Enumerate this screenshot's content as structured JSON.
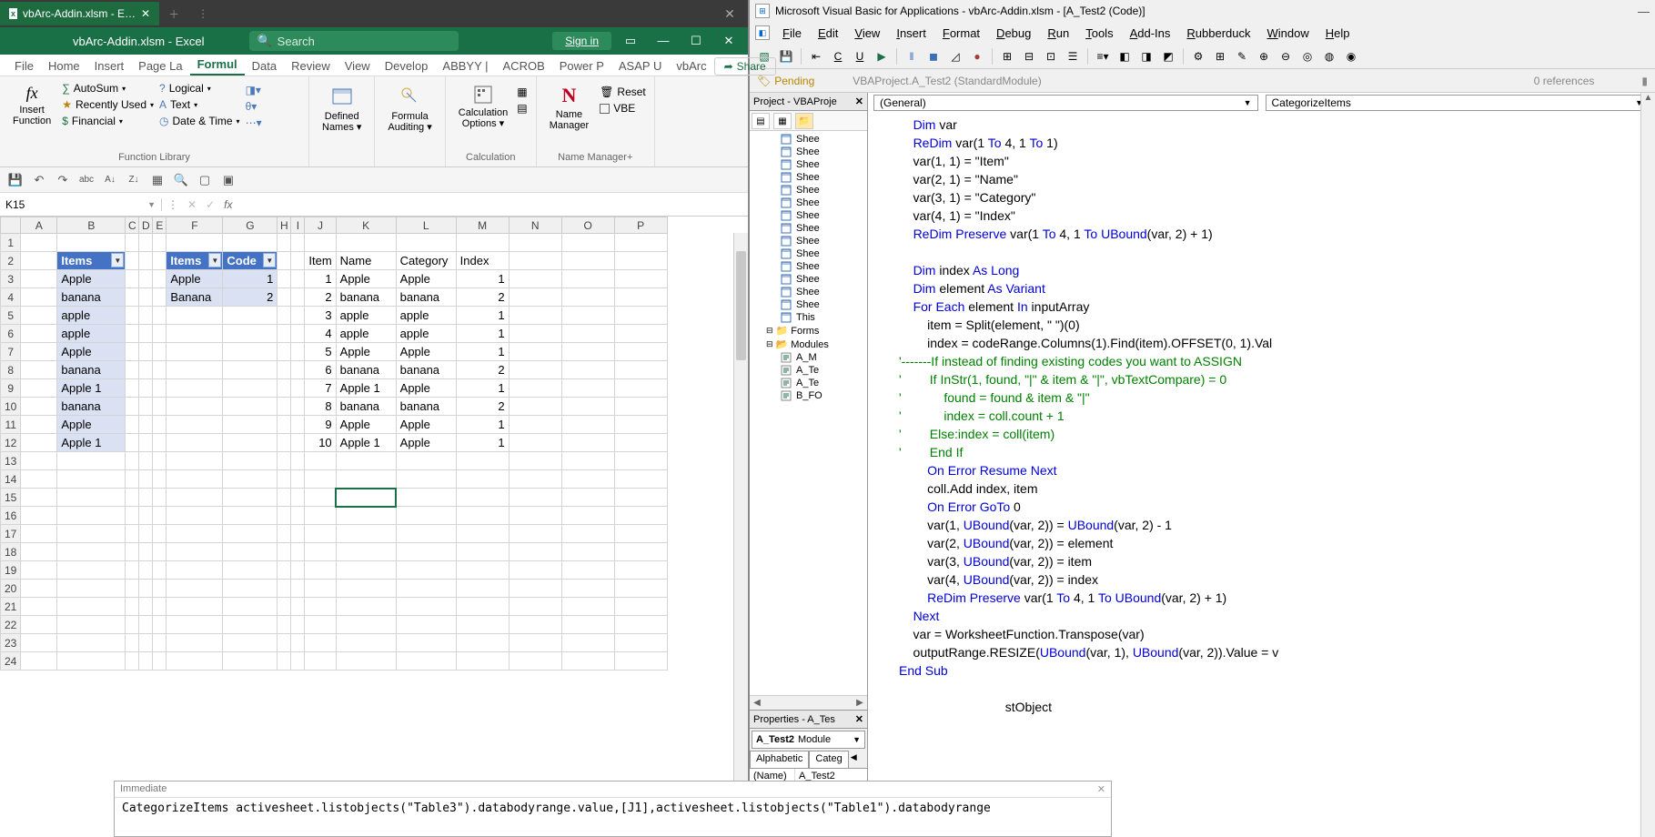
{
  "excel": {
    "tab_label": "vbArc-Addin.xlsm - E…",
    "doc_title": "vbArc-Addin.xlsm  -  Excel",
    "search_placeholder": "Search",
    "signin": "Sign in",
    "ribbon_tabs": [
      "File",
      "Home",
      "Insert",
      "Page La",
      "Formul",
      "Data",
      "Review",
      "View",
      "Develop",
      "ABBYY |",
      "ACROB",
      "Power P",
      "ASAP U",
      "vbArc"
    ],
    "share": "Share",
    "fn_group": {
      "insert_fn": "Insert\nFunction",
      "autosum": "AutoSum",
      "recent": "Recently Used",
      "financial": "Financial",
      "logical": "Logical",
      "text": "Text",
      "datetime": "Date & Time",
      "label": "Function Library"
    },
    "defined_names": "Defined\nNames",
    "formula_auditing": "Formula\nAuditing",
    "calc_options": "Calculation\nOptions",
    "calc_label": "Calculation",
    "name_mgr": "Name\nManager",
    "reset": "Reset",
    "vbe_chk": "VBE",
    "name_mgr_label": "Name Manager+",
    "namebox": "K15",
    "cols": [
      "",
      "A",
      "B",
      "C",
      "D",
      "E",
      "F",
      "G",
      "H",
      "I",
      "J",
      "K",
      "L",
      "M",
      "N",
      "O",
      "P"
    ],
    "table1_hdr": [
      "Items"
    ],
    "table1": [
      "Apple",
      "banana",
      "apple",
      "apple",
      "Apple",
      "banana",
      "Apple 1",
      "banana",
      "Apple",
      "Apple 1"
    ],
    "table2_hdr": [
      "Items",
      "Code"
    ],
    "table2": [
      [
        "Apple",
        "1"
      ],
      [
        "Banana",
        "2"
      ]
    ],
    "table3_hdr": [
      "Item",
      "Name",
      "Category",
      "Index"
    ],
    "table3": [
      [
        "1",
        "Apple",
        "Apple",
        "1"
      ],
      [
        "2",
        "banana",
        "banana",
        "2"
      ],
      [
        "3",
        "apple",
        "apple",
        "1"
      ],
      [
        "4",
        "apple",
        "apple",
        "1"
      ],
      [
        "5",
        "Apple",
        "Apple",
        "1"
      ],
      [
        "6",
        "banana",
        "banana",
        "2"
      ],
      [
        "7",
        "Apple 1",
        "Apple",
        "1"
      ],
      [
        "8",
        "banana",
        "banana",
        "2"
      ],
      [
        "9",
        "Apple",
        "Apple",
        "1"
      ],
      [
        "10",
        "Apple 1",
        "Apple",
        "1"
      ]
    ]
  },
  "immediate": {
    "title": "Immediate",
    "body": "CategorizeItems activesheet.listobjects(\"Table3\").databodyrange.value,[J1],activesheet.listobjects(\"Table1\").databodyrange"
  },
  "vbe": {
    "title": "Microsoft Visual Basic for Applications - vbArc-Addin.xlsm - [A_Test2 (Code)]",
    "menus": [
      "File",
      "Edit",
      "View",
      "Insert",
      "Format",
      "Debug",
      "Run",
      "Tools",
      "Add-Ins",
      "Rubberduck",
      "Window",
      "Help"
    ],
    "pending": "Pending",
    "module_path": "VBAProject.A_Test2 (StandardModule)",
    "refs": "0 references",
    "project_title": "Project - VBAProje",
    "tree_sheets": [
      "Shee",
      "Shee",
      "Shee",
      "Shee",
      "Shee",
      "Shee",
      "Shee",
      "Shee",
      "Shee",
      "Shee",
      "Shee",
      "Shee",
      "Shee",
      "Shee",
      "This"
    ],
    "tree_forms": "Forms",
    "tree_modules": "Modules",
    "tree_mods": [
      "A_M",
      "A_Te",
      "A_Te",
      "B_FO"
    ],
    "props_title": "Properties - A_Tes",
    "props_module": "A_Test2",
    "props_type": "Module",
    "props_tabs": [
      "Alphabetic",
      "Categ"
    ],
    "props_name_k": "(Name)",
    "props_name_v": "A_Test2",
    "code_dd1": "(General)",
    "code_dd2": "CategorizeItems",
    "code_lines": [
      [
        {
          "t": "    "
        },
        {
          "t": "Dim",
          "c": "kw"
        },
        {
          "t": " var"
        }
      ],
      [
        {
          "t": "    "
        },
        {
          "t": "ReDim",
          "c": "kw"
        },
        {
          "t": " var(1 "
        },
        {
          "t": "To",
          "c": "kw"
        },
        {
          "t": " 4, 1 "
        },
        {
          "t": "To",
          "c": "kw"
        },
        {
          "t": " 1)"
        }
      ],
      [
        {
          "t": "    var(1, 1) = \"Item\""
        }
      ],
      [
        {
          "t": "    var(2, 1) = \"Name\""
        }
      ],
      [
        {
          "t": "    var(3, 1) = \"Category\""
        }
      ],
      [
        {
          "t": "    var(4, 1) = \"Index\""
        }
      ],
      [
        {
          "t": "    "
        },
        {
          "t": "ReDim Preserve",
          "c": "kw"
        },
        {
          "t": " var(1 "
        },
        {
          "t": "To",
          "c": "kw"
        },
        {
          "t": " 4, 1 "
        },
        {
          "t": "To",
          "c": "kw"
        },
        {
          "t": " "
        },
        {
          "t": "UBound",
          "c": "kw"
        },
        {
          "t": "(var, 2) + 1)"
        }
      ],
      [
        {
          "t": "    "
        }
      ],
      [
        {
          "t": "    "
        },
        {
          "t": "Dim",
          "c": "kw"
        },
        {
          "t": " index "
        },
        {
          "t": "As Long",
          "c": "kw"
        }
      ],
      [
        {
          "t": "    "
        },
        {
          "t": "Dim",
          "c": "kw"
        },
        {
          "t": " element "
        },
        {
          "t": "As Variant",
          "c": "kw"
        }
      ],
      [
        {
          "t": "    "
        },
        {
          "t": "For Each",
          "c": "kw"
        },
        {
          "t": " element "
        },
        {
          "t": "In",
          "c": "kw"
        },
        {
          "t": " inputArray"
        }
      ],
      [
        {
          "t": "        item = Split(element, \" \")(0)"
        }
      ],
      [
        {
          "t": "        index = codeRange.Columns(1).Find(item).OFFSET(0, 1).Val"
        }
      ],
      [
        {
          "t": "'-------If instead of finding existing codes you want to ASSIGN",
          "c": "cm"
        }
      ],
      [
        {
          "t": "'        If InStr(1, found, \"|\" & item & \"|\", vbTextCompare) = 0",
          "c": "cm"
        }
      ],
      [
        {
          "t": "'            found = found & item & \"|\"",
          "c": "cm"
        }
      ],
      [
        {
          "t": "'            index = coll.count + 1",
          "c": "cm"
        }
      ],
      [
        {
          "t": "'        Else:index = coll(item)",
          "c": "cm"
        }
      ],
      [
        {
          "t": "'        End If",
          "c": "cm"
        }
      ],
      [
        {
          "t": "        "
        },
        {
          "t": "On Error Resume Next",
          "c": "kw"
        }
      ],
      [
        {
          "t": "        coll.Add index, item"
        }
      ],
      [
        {
          "t": "        "
        },
        {
          "t": "On Error GoTo",
          "c": "kw"
        },
        {
          "t": " 0"
        }
      ],
      [
        {
          "t": "        var(1, "
        },
        {
          "t": "UBound",
          "c": "kw"
        },
        {
          "t": "(var, 2)) = "
        },
        {
          "t": "UBound",
          "c": "kw"
        },
        {
          "t": "(var, 2) - 1"
        }
      ],
      [
        {
          "t": "        var(2, "
        },
        {
          "t": "UBound",
          "c": "kw"
        },
        {
          "t": "(var, 2)) = element"
        }
      ],
      [
        {
          "t": "        var(3, "
        },
        {
          "t": "UBound",
          "c": "kw"
        },
        {
          "t": "(var, 2)) = item"
        }
      ],
      [
        {
          "t": "        var(4, "
        },
        {
          "t": "UBound",
          "c": "kw"
        },
        {
          "t": "(var, 2)) = index"
        }
      ],
      [
        {
          "t": "        "
        },
        {
          "t": "ReDim Preserve",
          "c": "kw"
        },
        {
          "t": " var(1 "
        },
        {
          "t": "To",
          "c": "kw"
        },
        {
          "t": " 4, 1 "
        },
        {
          "t": "To",
          "c": "kw"
        },
        {
          "t": " "
        },
        {
          "t": "UBound",
          "c": "kw"
        },
        {
          "t": "(var, 2) + 1)"
        }
      ],
      [
        {
          "t": "    "
        },
        {
          "t": "Next",
          "c": "kw"
        }
      ],
      [
        {
          "t": "    var = WorksheetFunction.Transpose(var)"
        }
      ],
      [
        {
          "t": "    outputRange.RESIZE("
        },
        {
          "t": "UBound",
          "c": "kw"
        },
        {
          "t": "(var, 1), "
        },
        {
          "t": "UBound",
          "c": "kw"
        },
        {
          "t": "(var, 2)).Value = v"
        }
      ],
      [
        {
          "t": "End Sub",
          "c": "kw"
        }
      ],
      [
        {
          "t": ""
        }
      ],
      [
        {
          "t": "                              stObject"
        }
      ],
      [
        {
          "t": ""
        }
      ]
    ]
  }
}
